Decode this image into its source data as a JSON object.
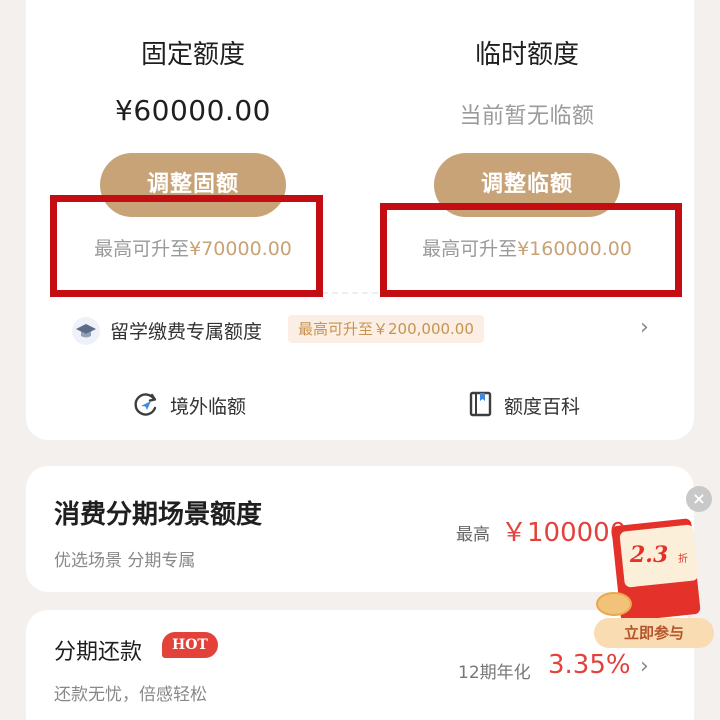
{
  "limits": {
    "fixed": {
      "title": "固定额度",
      "value": "¥60000.00",
      "button": "调整固额",
      "max_prefix": "最高可升至",
      "max_amount": "¥70000.00"
    },
    "temporary": {
      "title": "临时额度",
      "value": "当前暂无临额",
      "button": "调整临额",
      "max_prefix": "最高可升至",
      "max_amount": "¥160000.00"
    }
  },
  "study_abroad": {
    "label": "留学缴费专属额度",
    "tag": "最高可升至￥200,000.00",
    "icon": "graduation-cap-icon"
  },
  "links": [
    {
      "label": "境外临额",
      "icon": "refresh-plane-icon"
    },
    {
      "label": "额度百科",
      "icon": "book-icon"
    }
  ],
  "scene": {
    "title": "消费分期场景额度",
    "subtitle": "优选场景 分期专属",
    "max_label": "最高",
    "max_value": "￥100000"
  },
  "installment": {
    "title": "分期还款",
    "badge": "HOT",
    "subtitle": "还款无忧，倍感轻松",
    "rate_label": "12期年化",
    "rate_value": "3.35%"
  },
  "promo": {
    "discount": "2.3",
    "unit": "折",
    "button": "立即参与",
    "close": "×"
  },
  "colors": {
    "gold": "#c7a377",
    "red": "#e3423a",
    "highlight_box": "#c40d12"
  }
}
